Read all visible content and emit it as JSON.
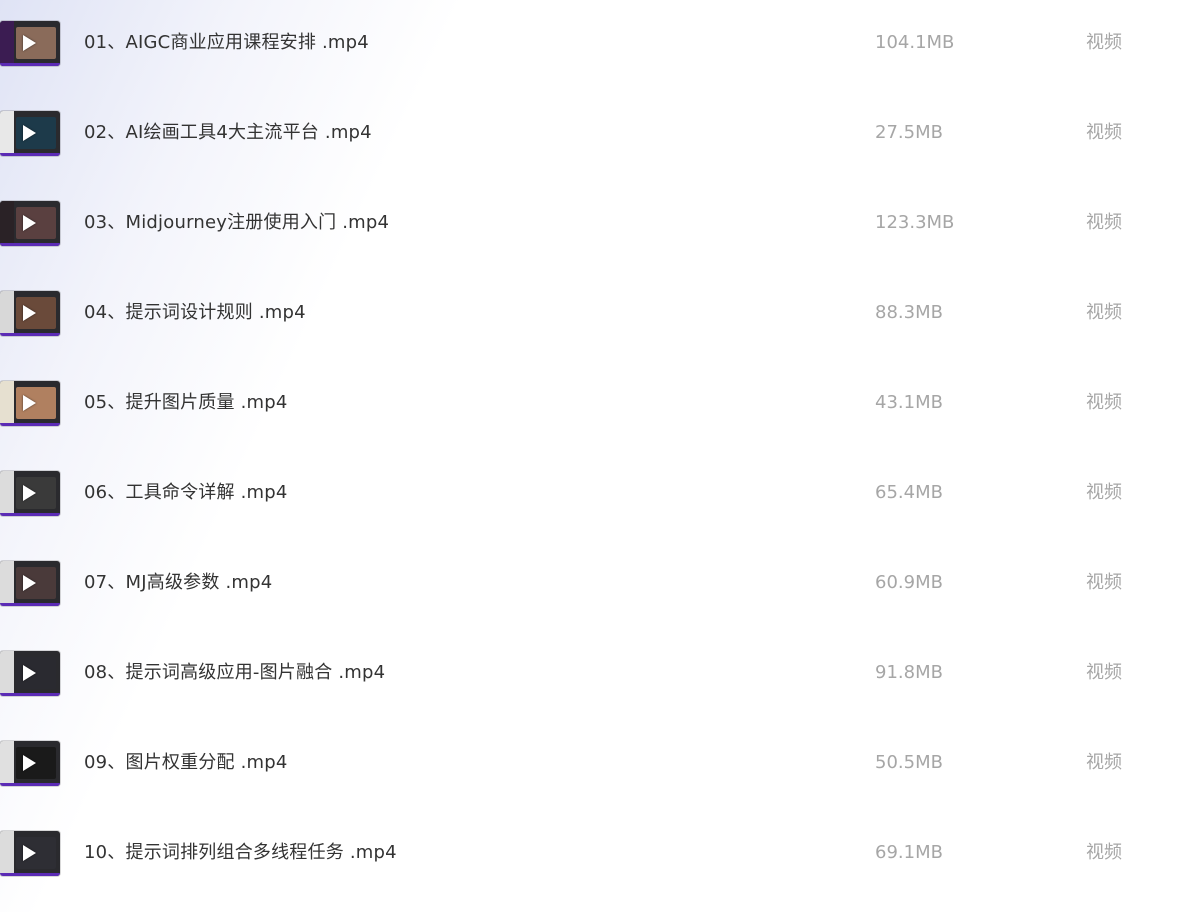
{
  "files": [
    {
      "name": "01、AIGC商业应用课程安排 .mp4",
      "size": "104.1MB",
      "type": "视频",
      "thumb_colors": [
        "#3b1c52",
        "#8a6b5a"
      ]
    },
    {
      "name": "02、AI绘画工具4大主流平台 .mp4",
      "size": "27.5MB",
      "type": "视频",
      "thumb_colors": [
        "#e8e8e8",
        "#1d3a4a"
      ]
    },
    {
      "name": "03、Midjourney注册使用入门 .mp4",
      "size": "123.3MB",
      "type": "视频",
      "thumb_colors": [
        "#2a2226",
        "#5a4040"
      ]
    },
    {
      "name": "04、提示词设计规则 .mp4",
      "size": "88.3MB",
      "type": "视频",
      "thumb_colors": [
        "#d8d8d8",
        "#6a4a3a"
      ]
    },
    {
      "name": "05、提升图片质量 .mp4",
      "size": "43.1MB",
      "type": "视频",
      "thumb_colors": [
        "#e6e0d0",
        "#b08060"
      ]
    },
    {
      "name": "06、工具命令详解 .mp4",
      "size": "65.4MB",
      "type": "视频",
      "thumb_colors": [
        "#dcdcdc",
        "#3a3a3a"
      ]
    },
    {
      "name": "07、MJ高级参数 .mp4",
      "size": "60.9MB",
      "type": "视频",
      "thumb_colors": [
        "#dcdcdc",
        "#4a3a3a"
      ]
    },
    {
      "name": "08、提示词高级应用-图片融合 .mp4",
      "size": "91.8MB",
      "type": "视频",
      "thumb_colors": [
        "#dcdcdc",
        "#2a2a30"
      ]
    },
    {
      "name": "09、图片权重分配 .mp4",
      "size": "50.5MB",
      "type": "视频",
      "thumb_colors": [
        "#e0e0e0",
        "#1a1a1a"
      ]
    },
    {
      "name": "10、提示词排列组合多线程任务 .mp4",
      "size": "69.1MB",
      "type": "视频",
      "thumb_colors": [
        "#dcdcdc",
        "#2e2e34"
      ]
    }
  ]
}
